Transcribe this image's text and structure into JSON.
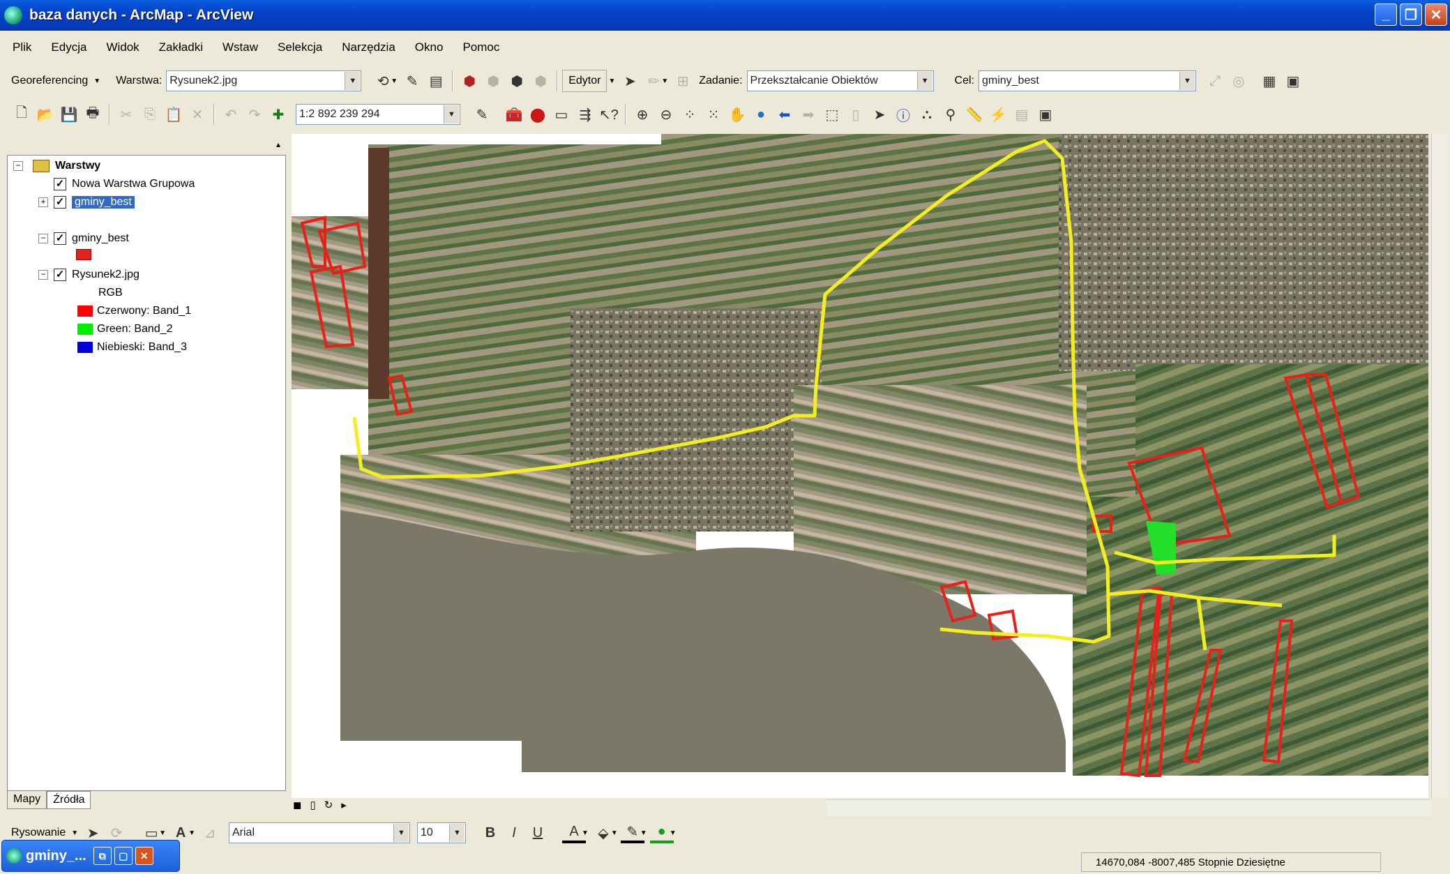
{
  "window": {
    "title": "baza danych - ArcMap - ArcView",
    "minimize": "_",
    "maximize": "❐",
    "close": "✕"
  },
  "menu": [
    "Plik",
    "Edycja",
    "Widok",
    "Zakładki",
    "Wstaw",
    "Selekcja",
    "Narzędzia",
    "Okno",
    "Pomoc"
  ],
  "toolbar1": {
    "georef_label": "Georeferencing",
    "layer_label": "Warstwa:",
    "layer_value": "Rysunek2.jpg",
    "edit_label": "Edytor",
    "task_label": "Zadanie:",
    "task_value": "Przekształcanie Obiektów",
    "target_label": "Cel:",
    "target_value": "gminy_best"
  },
  "toolbar2": {
    "scale_value": "1:2 892 239 294"
  },
  "toc": {
    "root": "Warstwy",
    "items": {
      "group": "Nowa Warstwa Grupowa",
      "gminy1": "gminy_best",
      "gminy2": "gminy_best",
      "raster": "Rysunek2.jpg",
      "rgb": "RGB",
      "red": "Czerwony:   Band_1",
      "green": "Green: Band_2",
      "blue": "Niebieski:   Band_3"
    },
    "tabs": [
      "Mapy",
      "Źródła"
    ]
  },
  "drawing": {
    "rysowanie_label": "Rysowanie",
    "font_value": "Arial",
    "size_value": "10",
    "bold": "B",
    "italic": "I",
    "underline": "U",
    "font_color_glyph": "A"
  },
  "status": {
    "coords": "14670,084  -8007,485 Stopnie Dziesiętne"
  },
  "taskbar": {
    "label": "gminy_..."
  },
  "colors": {
    "route": "#f2ee22",
    "parcel_outline": "#e8201a",
    "green_patch": "#22e02a"
  }
}
